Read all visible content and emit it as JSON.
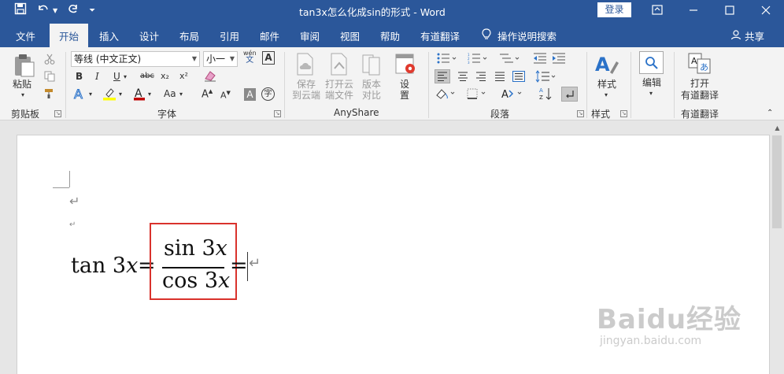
{
  "title_bar": {
    "document_title": "tan3x怎么化成sin的形式  -  Word",
    "login_label": "登录",
    "icons": [
      "save-icon",
      "undo-icon",
      "redo-icon",
      "customize-qat-icon",
      "ribbon-display-icon",
      "minimize-icon",
      "maximize-icon",
      "close-icon"
    ]
  },
  "tabs": [
    {
      "label": "文件"
    },
    {
      "label": "开始"
    },
    {
      "label": "插入"
    },
    {
      "label": "设计"
    },
    {
      "label": "布局"
    },
    {
      "label": "引用"
    },
    {
      "label": "邮件"
    },
    {
      "label": "审阅"
    },
    {
      "label": "视图"
    },
    {
      "label": "帮助"
    },
    {
      "label": "有道翻译"
    }
  ],
  "active_tab": "开始",
  "tell_me": "操作说明搜索",
  "share_label": "共享",
  "ribbon": {
    "clipboard": {
      "paste_label": "粘贴",
      "group_label": "剪贴板"
    },
    "font": {
      "font_name": "等线 (中文正文)",
      "font_size": "小一",
      "phonetic_glyph": "wén",
      "phonetic_sub": "文",
      "border_char": "A",
      "bold": "B",
      "italic": "I",
      "underline": "U",
      "strike": "abc",
      "subscript": "x₂",
      "superscript": "x²",
      "grow": "A",
      "shrink": "A",
      "case": "Aa",
      "shade": "A",
      "enclose": "字",
      "group_label": "字体"
    },
    "anyshare": {
      "save_cloud": [
        "保存",
        "到云端"
      ],
      "open_cloud": [
        "打开云",
        "端文件"
      ],
      "version": [
        "版本",
        "对比"
      ],
      "settings": [
        "设",
        "置"
      ],
      "group_label": "AnyShare"
    },
    "paragraph": {
      "group_label": "段落"
    },
    "styles": {
      "label": "样式",
      "group_label": "样式"
    },
    "editing": {
      "label": "编辑"
    },
    "youdao": {
      "label_line1": "打开",
      "label_line2": "有道翻译",
      "group_label": "有道翻译"
    }
  },
  "document": {
    "equation": {
      "lhs_fn": "tan 3",
      "var": "x",
      "eq": "=",
      "num_fn": "sin 3",
      "den_fn": "cos 3"
    },
    "para_mark": "↵"
  },
  "watermark": {
    "text": "Baidu经验",
    "sub": "jingyan.baidu.com"
  },
  "colors": {
    "brand": "#2b579a",
    "highlight_box": "#d9322c"
  }
}
